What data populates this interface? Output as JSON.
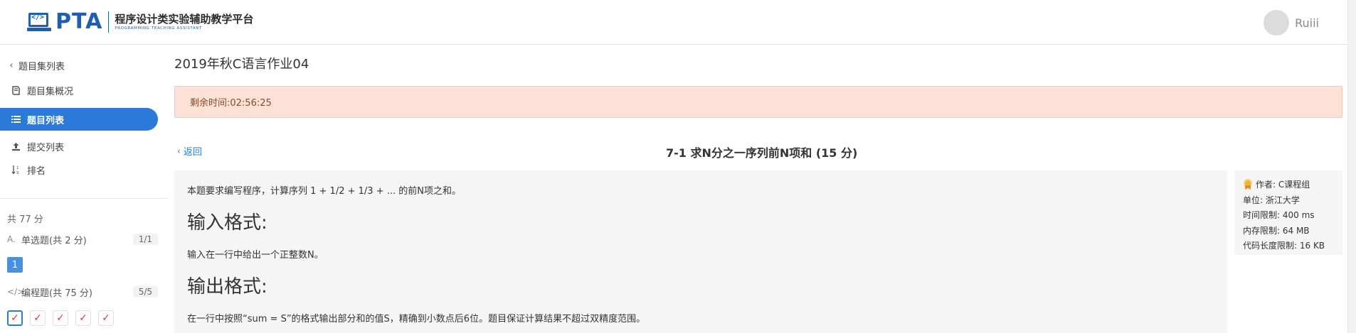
{
  "header": {
    "logo_text": "PTA",
    "logo_code_glyph": "</>",
    "platform_name": "程序设计类实验辅助教学平台",
    "platform_name_en": "PROGRAMMING TEACHING ASSISTANT",
    "username": "Ruiii"
  },
  "sidebar": {
    "back_label": "题目集列表",
    "items": [
      {
        "label": "题目集概况",
        "icon": "book-icon"
      },
      {
        "label": "题目列表",
        "icon": "list-icon",
        "active": true
      },
      {
        "label": "提交列表",
        "icon": "upload-icon"
      },
      {
        "label": "排名",
        "icon": "sort-icon"
      }
    ],
    "total_score": "共 77 分",
    "groups": [
      {
        "icon_text": "A.",
        "label": "单选题(共 2 分)",
        "count": "1/1"
      },
      {
        "icon_text": "</>",
        "label": "编程题(共 75 分)",
        "count": "5/5"
      }
    ],
    "single_choice_numbers": [
      "1"
    ],
    "programming_checks": [
      "✓",
      "✓",
      "✓",
      "✓",
      "✓"
    ]
  },
  "main": {
    "assignment_title": "2019年秋C语言作业04",
    "timer_text": "剩余时间:02:56:25",
    "back_label": "返回",
    "problem_title": "7-1 求N分之一序列前N项和 (15 分)",
    "description": "本题要求编写程序，计算序列 1 + 1/2 + 1/3 + ... 的前N项之和。",
    "input_heading": "输入格式:",
    "input_text": "输入在一行中给出一个正整数N。",
    "output_heading": "输出格式:",
    "output_text": "在一行中按照“sum = S”的格式输出部分和的值S，精确到小数点后6位。题目保证计算结果不超过双精度范围。"
  },
  "info": {
    "author": "作者: C课程组",
    "unit": "单位: 浙江大学",
    "time_limit": "时间限制: 400 ms",
    "memory_limit": "内存限制: 64 MB",
    "code_limit": "代码长度限制: 16 KB"
  },
  "colors": {
    "brand": "#1c5fb3",
    "active": "#2b7ad9",
    "alert_bg": "#fbe1d6",
    "wrong": "#e0323c"
  }
}
